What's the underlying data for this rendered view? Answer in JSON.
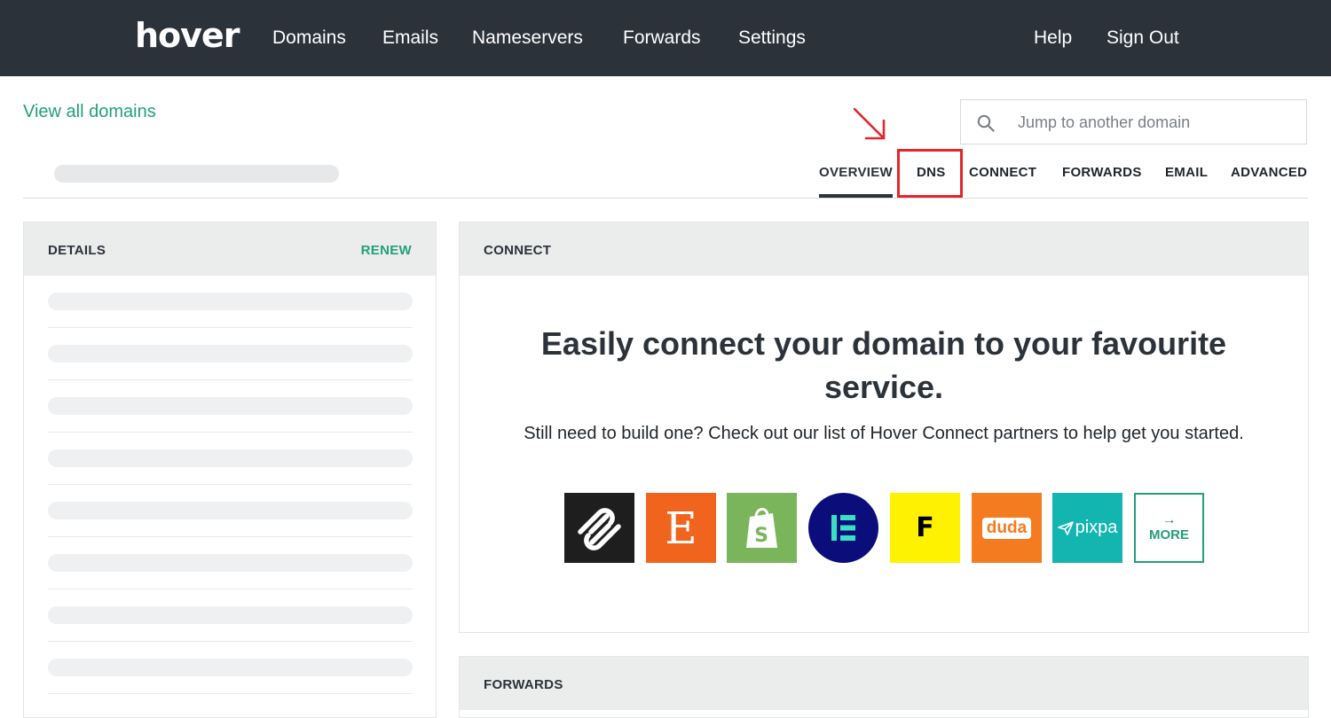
{
  "nav": {
    "logo": "hover",
    "links": [
      "Domains",
      "Emails",
      "Nameservers",
      "Forwards",
      "Settings"
    ],
    "right_links": [
      "Help",
      "Sign Out"
    ]
  },
  "header": {
    "view_all": "View all domains",
    "search_placeholder": "Jump to another domain"
  },
  "tabs": [
    "OVERVIEW",
    "DNS",
    "CONNECT",
    "FORWARDS",
    "EMAIL",
    "ADVANCED"
  ],
  "active_tab": "OVERVIEW",
  "details": {
    "title": "DETAILS",
    "renew": "RENEW"
  },
  "connect": {
    "title": "CONNECT",
    "headline": "Easily connect your domain to your favourite service.",
    "subtext": "Still need to build one? Check out our list of Hover Connect partners to help get you started.",
    "partners": [
      {
        "icon": "squarespace-logo-icon",
        "bg": "#1e1e1e"
      },
      {
        "icon": "etsy-logo-icon",
        "bg": "#f1641e",
        "glyph": "E"
      },
      {
        "icon": "shopify-logo-icon",
        "bg": "#7ab55c"
      },
      {
        "icon": "elementor-logo-icon",
        "bg": "#0b0d7a"
      },
      {
        "icon": "format-logo-icon",
        "bg": "#fff200",
        "glyph": "F"
      },
      {
        "icon": "duda-logo-icon",
        "bg": "#f47b20",
        "glyph": "duda"
      },
      {
        "icon": "pixpa-logo-icon",
        "bg": "#13b5b1",
        "glyph": "pixpa"
      }
    ],
    "more_arrow": "→",
    "more_label": "MORE"
  },
  "forwards": {
    "title": "FORWARDS"
  },
  "colors": {
    "nav_bg": "#2c323a",
    "accent": "#22a07a",
    "annotation": "#e3262b"
  }
}
